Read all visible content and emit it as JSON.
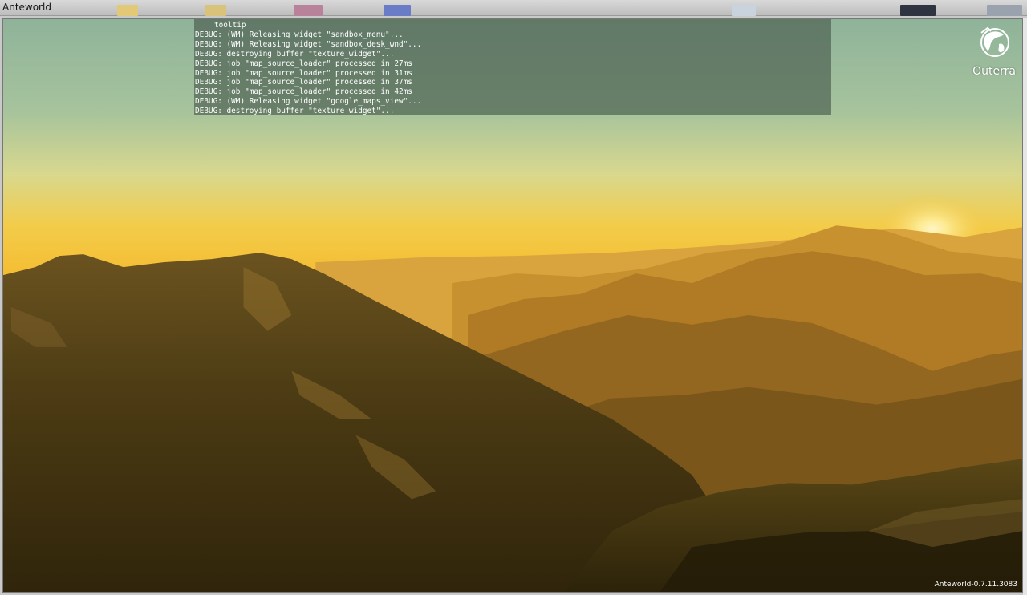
{
  "window": {
    "title": "Anteworld"
  },
  "console": {
    "lines": [
      "tooltip",
      "DEBUG: (WM) Releasing widget \"sandbox_menu\"...",
      "DEBUG: (WM) Releasing widget \"sandbox_desk_wnd\"...",
      "DEBUG: destroying buffer \"texture_widget\"...",
      "DEBUG: job \"map_source_loader\" processed in 27ms",
      "DEBUG: job \"map_source_loader\" processed in 31ms",
      "DEBUG: job \"map_source_loader\" processed in 37ms",
      "DEBUG: job \"map_source_loader\" processed in 42ms",
      "DEBUG: (WM) Releasing widget \"google_maps_view\"...",
      "DEBUG: destroying buffer \"texture_widget\"..."
    ]
  },
  "logo": {
    "text": "Outerra",
    "icon": "outerra-globe-icon"
  },
  "status": {
    "version": "Anteworld-0.7.11.3083"
  },
  "colors": {
    "sky_top": "#8fb39a",
    "sky_horizon": "#f6c640",
    "sun": "#fff6c8",
    "terrain_dark": "#3a2d0f"
  }
}
